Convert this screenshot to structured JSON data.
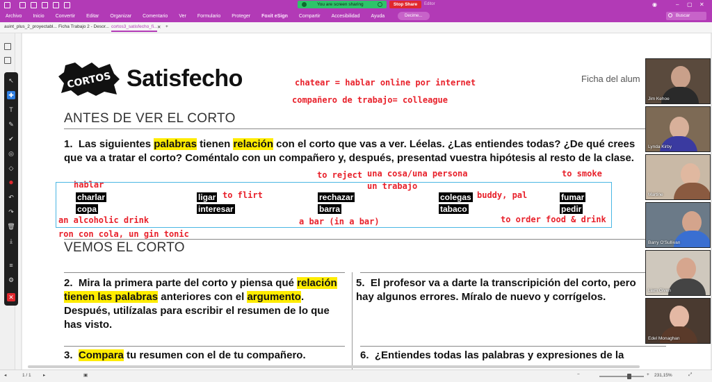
{
  "app": {
    "menu": [
      "Archivo",
      "Inicio",
      "Convertir",
      "Editar",
      "Organizar",
      "Comentario",
      "Ver",
      "Formulario",
      "Proteger",
      "Foxit eSign",
      "Compartir",
      "Accesibilidad",
      "Ayuda"
    ],
    "active_menu": "Foxit eSign",
    "share_text": "You are screen sharing",
    "stop_share": "Stop Share",
    "editor_label": "Editor",
    "tell_me": "Decime...",
    "search_placeholder": "Buscar",
    "accent": "#b23ab6"
  },
  "tabs": [
    {
      "label": "auint_plus_2_proyectabl..."
    },
    {
      "label": "Ficha Trabajo 2 - Desor..."
    },
    {
      "label": "cortos3_satisfecho_fi..."
    }
  ],
  "doc": {
    "logo_text": "CORTOS",
    "title": "Satisfecho",
    "ficha": "Ficha del alum",
    "section1": "ANTES DE VER EL CORTO",
    "q1": {
      "num": "1.",
      "p1": "Las siguientes ",
      "h1": "palabras",
      "p2": " tienen ",
      "h2": "relación",
      "p3": " con el corto que vas a ver. Léelas. ¿Las entiendes todas? ¿De qué crees que va a tratar el corto? Coméntalo con un compañero y, después, presentad vuestra hipótesis al resto de la clase."
    },
    "vocab": [
      "charlar",
      "ligar",
      "rechazar",
      "colegas",
      "fumar",
      "copa",
      "interesar",
      "barra",
      "tabaco",
      "pedir"
    ],
    "section2": "VEMOS EL CORTO",
    "q2": {
      "num": "2.",
      "p1": "Mira la primera parte del corto y piensa qué ",
      "h1": "relación tienen las palabras",
      "p2": " anteriores con el ",
      "h2": "argumento",
      "p3": ". Después, utilízalas para escribir el resumen de lo que has visto."
    },
    "q3": {
      "num": "3.",
      "h1": "Compara",
      "p1": " tu resumen con el de tu compañero."
    },
    "q5": {
      "num": "5.",
      "p1": "El profesor va a darte la transcripición del corto, pero hay algunos errores. Míralo de nuevo y corrígelos."
    },
    "q6": {
      "num": "6.",
      "p1": "¿Entiendes todas las palabras y expresiones de la"
    }
  },
  "annotations": {
    "chatear": "chatear = hablar online por internet",
    "companero": "compañero de trabajo= colleague",
    "hablar": "hablar",
    "to_flirt": "to flirt",
    "to_reject": "to reject",
    "una_cosa": "una cosa/una persona",
    "un_trabajo": "un trabajo",
    "to_smoke": "to smoke",
    "buddy": "buddy, pal",
    "alcoholic": "an alcoholic drink",
    "bar": "a bar (in a bar)",
    "order": "to order food & drink",
    "ron": "ron con cola, un gin tonic"
  },
  "participants": [
    {
      "name": "Jim Kehoe"
    },
    {
      "name": "Lynda Kirby"
    },
    {
      "name": "Martine"
    },
    {
      "name": "Barry O'Sullivan"
    },
    {
      "name": "Liam Given"
    },
    {
      "name": "Edel Monaghan"
    }
  ],
  "status": {
    "page": "1 / 1",
    "zoom": "231,15%"
  }
}
